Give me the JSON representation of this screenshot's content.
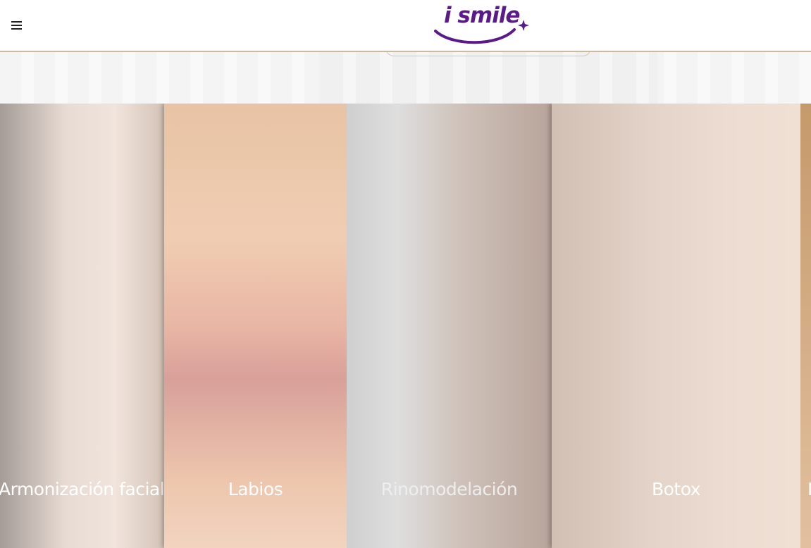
{
  "header": {
    "menu_icon": "hamburger-menu-icon",
    "logo_text": "i smile",
    "brand_color": "#5b1a8c",
    "accent_line_color": "#cdb9a0"
  },
  "panels": [
    {
      "label": "Armonización facial"
    },
    {
      "label": "Labios"
    },
    {
      "label": "Rinomodelación"
    },
    {
      "label": "Botox"
    },
    {
      "label": "N"
    }
  ]
}
